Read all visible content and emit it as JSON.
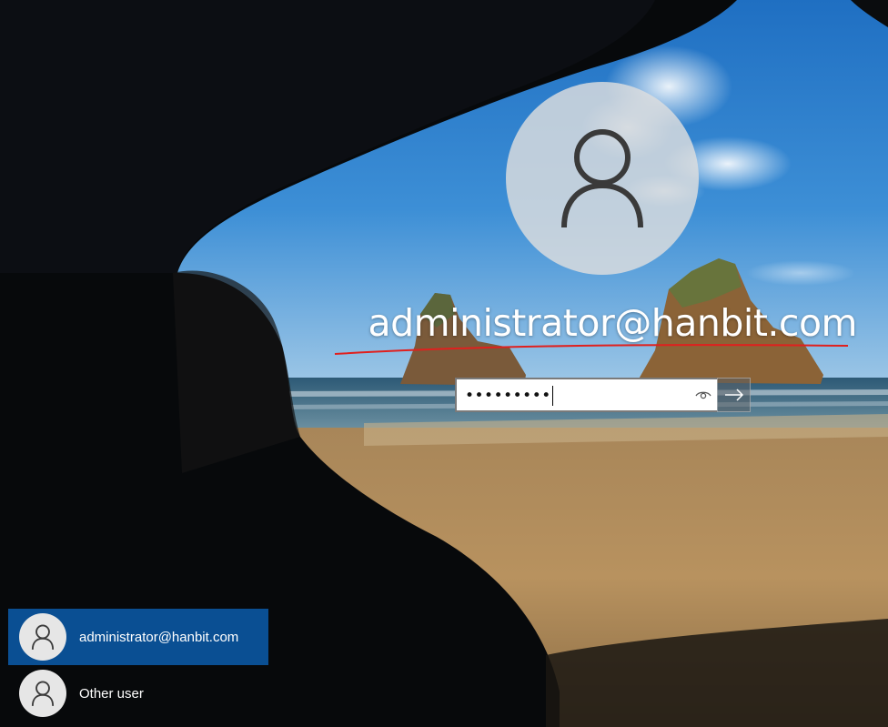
{
  "login": {
    "username": "administrator@hanbit.com",
    "password_masked": "•••••••••",
    "reveal_icon": "eye-icon",
    "submit_icon": "arrow-right-icon",
    "avatar_icon": "user-silhouette-icon"
  },
  "user_list": [
    {
      "name": "administrator@hanbit.com",
      "selected": true,
      "icon": "user-silhouette-icon"
    },
    {
      "name": "Other user",
      "selected": false,
      "icon": "user-silhouette-icon"
    }
  ],
  "colors": {
    "selected_user_background": "#0a4f93",
    "annotation_underline": "#e0201e",
    "avatar_circle": "#dedede"
  }
}
